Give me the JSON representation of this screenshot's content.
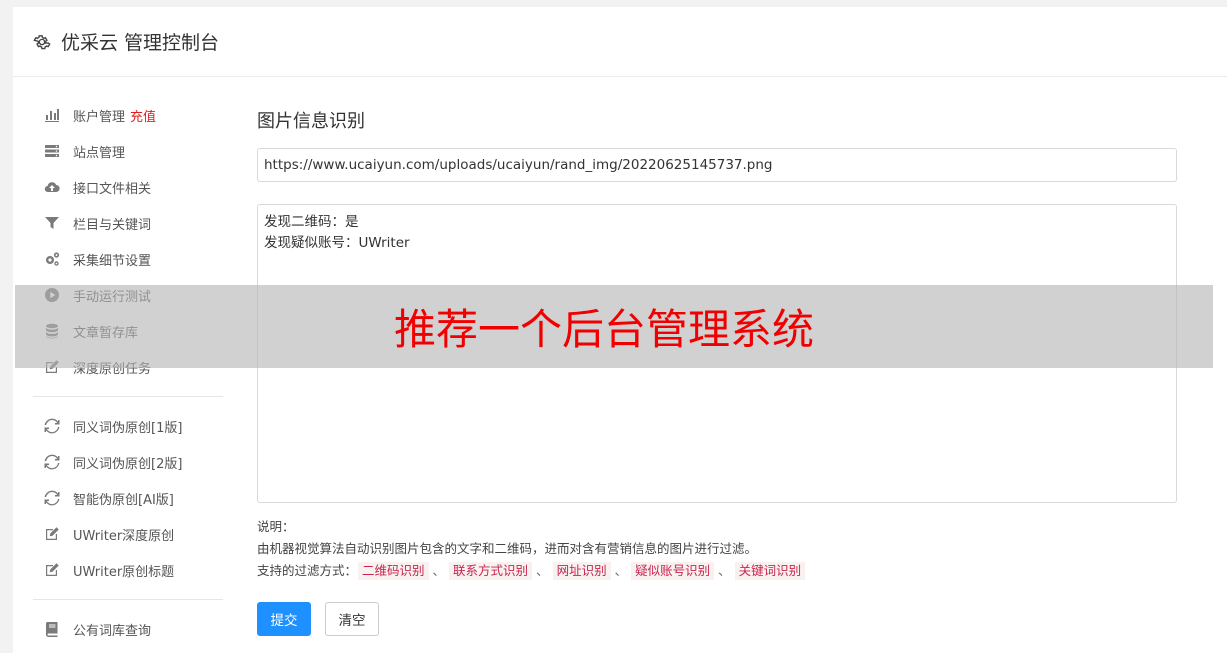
{
  "header": {
    "title": "优采云 管理控制台"
  },
  "sidebar": {
    "group1": [
      {
        "label": "账户管理",
        "tag": "充值",
        "icon": "bar-chart-icon"
      },
      {
        "label": "站点管理",
        "icon": "server-icon"
      },
      {
        "label": "接口文件相关",
        "icon": "cloud-upload-icon"
      },
      {
        "label": "栏目与关键词",
        "icon": "filter-icon"
      },
      {
        "label": "采集细节设置",
        "icon": "gears-icon"
      },
      {
        "label": "手动运行测试",
        "icon": "play-icon"
      },
      {
        "label": "文章暂存库",
        "icon": "database-icon"
      },
      {
        "label": "深度原创任务",
        "icon": "edit-icon"
      }
    ],
    "group2": [
      {
        "label": "同义词伪原创[1版]",
        "icon": "refresh-icon"
      },
      {
        "label": "同义词伪原创[2版]",
        "icon": "refresh-icon"
      },
      {
        "label": "智能伪原创[AI版]",
        "icon": "refresh-icon"
      },
      {
        "label": "UWriter深度原创",
        "icon": "edit-icon"
      },
      {
        "label": "UWriter原创标题",
        "icon": "edit-icon"
      }
    ],
    "group3": [
      {
        "label": "公有词库查询",
        "icon": "book-icon"
      }
    ]
  },
  "main": {
    "title": "图片信息识别",
    "url_value": "https://www.ucaiyun.com/uploads/ucaiyun/rand_img/20220625145737.png",
    "result_lines": [
      "发现二维码：是",
      "发现疑似账号：UWriter"
    ],
    "notes_label": "说明：",
    "notes_desc": "由机器视觉算法自动识别图片包含的文字和二维码，进而对含有营销信息的图片进行过滤。",
    "filter_label": "支持的过滤方式：",
    "filter_separator": "、",
    "filters": [
      "二维码识别",
      "联系方式识别",
      "网址识别",
      "疑似账号识别",
      "关键词识别"
    ],
    "submit_label": "提交",
    "clear_label": "清空"
  },
  "watermark": {
    "text": "推荐一个后台管理系统"
  },
  "colors": {
    "primary": "#1e90ff",
    "tag_red": "#e31c1c",
    "chip_text": "#c7254e",
    "chip_bg": "#f9f0f0",
    "watermark_text": "#f00000"
  }
}
